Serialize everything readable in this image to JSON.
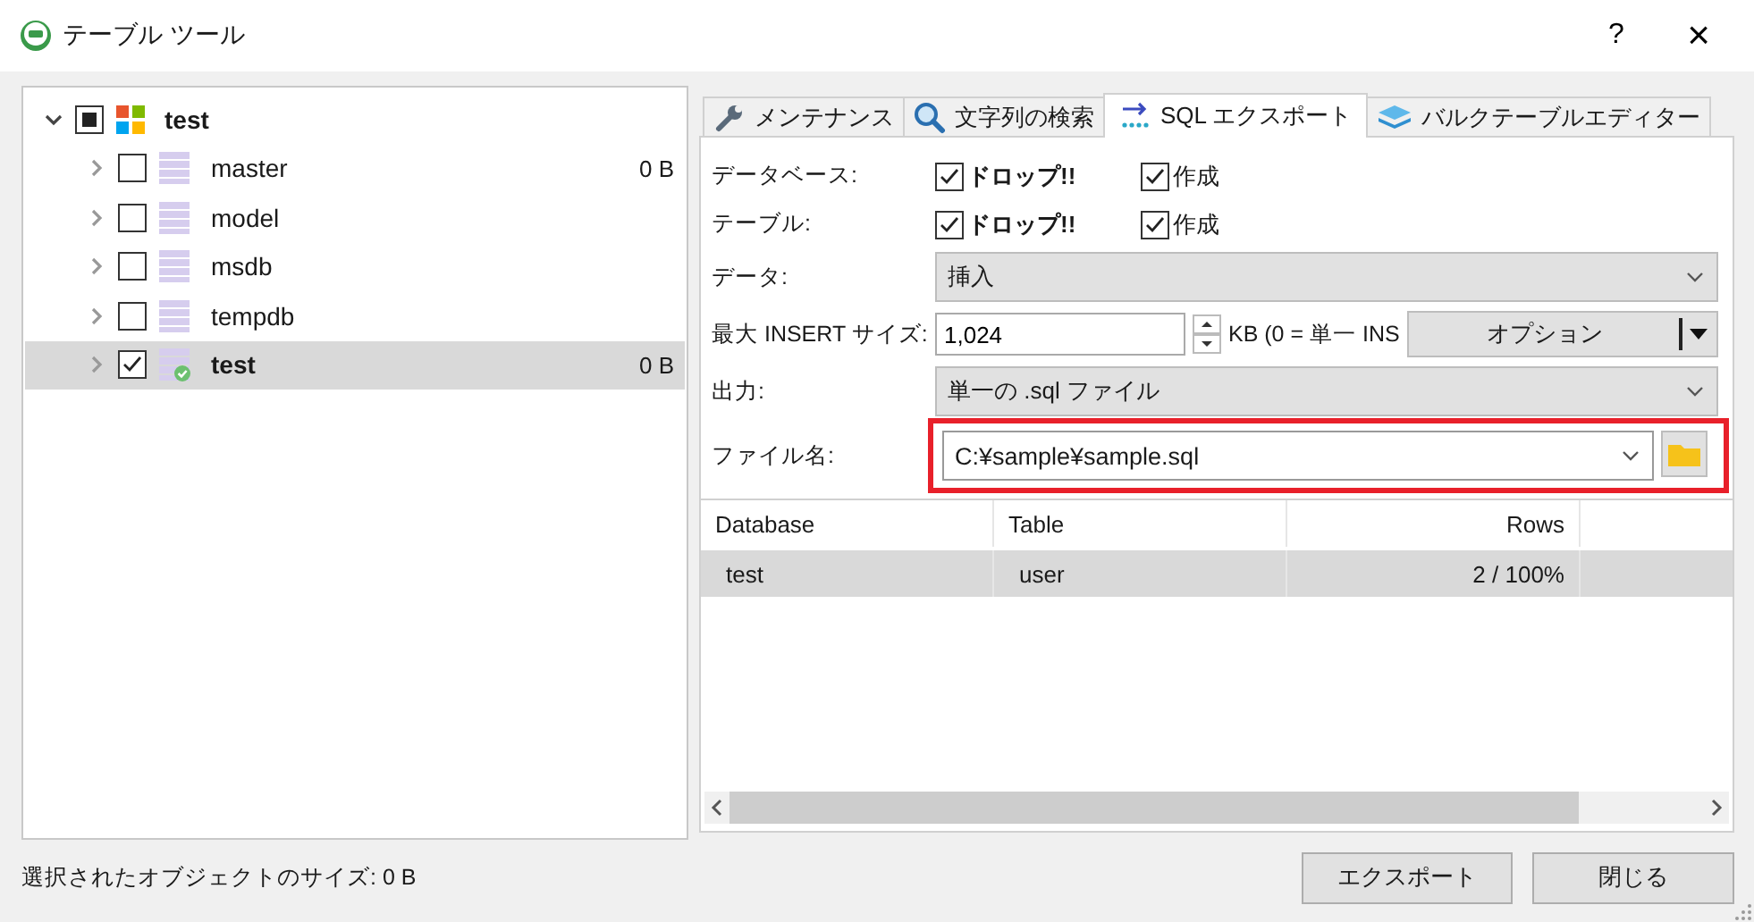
{
  "window": {
    "title": "テーブル ツール",
    "help": "?",
    "close": "×"
  },
  "tree": {
    "label": "test",
    "expanded": true,
    "indeterminate": true,
    "children": [
      {
        "label": "master",
        "size": "0 B",
        "checked": false,
        "expanded": false,
        "selected": false
      },
      {
        "label": "model",
        "checked": false,
        "expanded": false,
        "selected": false
      },
      {
        "label": "msdb",
        "checked": false,
        "expanded": false,
        "selected": false
      },
      {
        "label": "tempdb",
        "checked": false,
        "expanded": false,
        "selected": false
      },
      {
        "label": "test",
        "size": "0 B",
        "checked": true,
        "expanded": false,
        "selected": true
      }
    ]
  },
  "tabs": [
    {
      "label": "メンテナンス",
      "selected": false
    },
    {
      "label": "文字列の検索",
      "selected": false
    },
    {
      "label": "SQL エクスポート",
      "selected": true
    },
    {
      "label": "バルクテーブルエディター",
      "selected": false
    }
  ],
  "form": [
    {
      "kind": "checks",
      "label": "データベース:",
      "options": [
        {
          "label": "ドロップ!!",
          "checked": true
        },
        {
          "label": "作成",
          "checked": true
        }
      ]
    },
    {
      "kind": "checks",
      "label": "テーブル:",
      "options": [
        {
          "label": "ドロップ!!",
          "checked": true
        },
        {
          "label": "作成",
          "checked": true
        }
      ]
    },
    {
      "kind": "select",
      "label": "データ:",
      "value": "挿入"
    },
    {
      "kind": "spin",
      "label": "最大 INSERT サイズ:",
      "value": "1,024",
      "note": "KB (0 = 単一 INS",
      "button": "オプション"
    },
    {
      "kind": "select",
      "label": "出力:",
      "value": "単一の .sql ファイル"
    },
    {
      "kind": "file",
      "label": "ファイル名:",
      "value": "C:¥sample¥sample.sql"
    }
  ],
  "table": {
    "columns": [
      "Database",
      "Table",
      "Rows"
    ],
    "rows": [
      {
        "cells": [
          "test",
          "user",
          "2 / 100%"
        ],
        "selected": true
      }
    ]
  },
  "status_bar": "選択されたオブジェクトのサイズ: 0 B",
  "buttons": [
    "エクスポート",
    "閉じる"
  ]
}
